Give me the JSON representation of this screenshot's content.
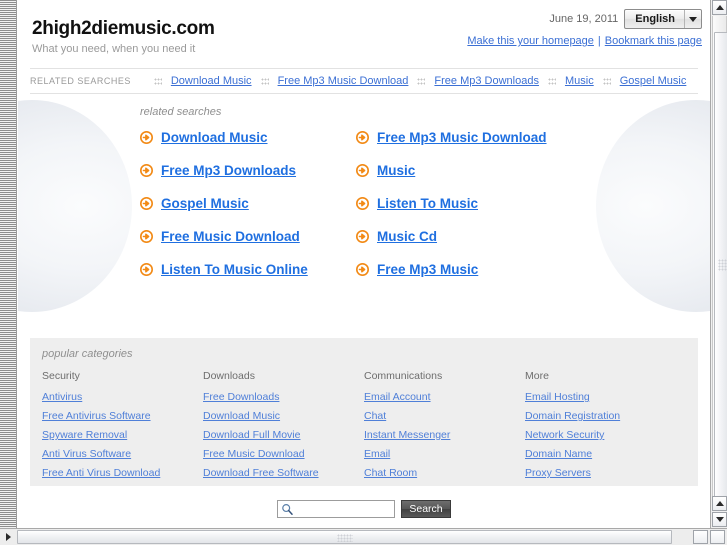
{
  "header": {
    "site_title": "2high2diemusic.com",
    "tagline": "What you need, when you need it",
    "date": "June 19, 2011",
    "language": "English",
    "make_homepage": "Make this your homepage",
    "separator": "|",
    "bookmark": "Bookmark this page"
  },
  "related_bar": {
    "label": "RELATED SEARCHES",
    "links": [
      "Download Music",
      "Free Mp3 Music Download",
      "Free Mp3 Downloads",
      "Music",
      "Gospel Music"
    ]
  },
  "main": {
    "caption": "related searches",
    "links": [
      "Download Music",
      "Free Mp3 Music Download",
      "Free Mp3 Downloads",
      "Music",
      "Gospel Music",
      "Listen To Music",
      "Free Music Download",
      "Music Cd",
      "Listen To Music Online",
      "Free Mp3 Music"
    ]
  },
  "categories": {
    "caption": "popular categories",
    "columns": [
      {
        "heading": "Security",
        "links": [
          "Antivirus",
          "Free Antivirus Software",
          "Spyware Removal",
          "Anti Virus Software",
          "Free Anti Virus Download"
        ]
      },
      {
        "heading": "Downloads",
        "links": [
          "Free Downloads",
          "Download Music",
          "Download Full Movie",
          "Free Music Download",
          "Download Free Software"
        ]
      },
      {
        "heading": "Communications",
        "links": [
          "Email Account",
          "Chat",
          "Instant Messenger",
          "Email",
          "Chat Room"
        ]
      },
      {
        "heading": "More",
        "links": [
          "Email Hosting",
          "Domain Registration",
          "Network Security",
          "Domain Name",
          "Proxy Servers"
        ]
      }
    ]
  },
  "search": {
    "value": "",
    "placeholder": "",
    "button_label": "Search"
  },
  "colors": {
    "link_blue": "#3b6fd4",
    "main_link_blue": "#1f6fe0",
    "arrow_orange": "#f28a16",
    "category_bg": "#eeeeee",
    "muted_text": "#9a9a9a"
  },
  "icons": {
    "arrow_circle": "arrow-circle-right-icon",
    "search": "search-icon",
    "dropdown": "chevron-down-icon"
  }
}
